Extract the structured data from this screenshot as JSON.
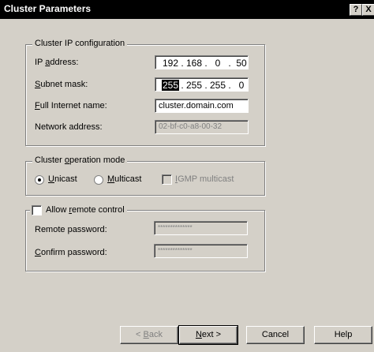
{
  "window": {
    "title": "Cluster Parameters",
    "help_glyph": "?",
    "close_glyph": "X"
  },
  "cluster_ip": {
    "group_label": "Cluster IP configuration",
    "ip_label_pre": "IP ",
    "ip_label_key": "a",
    "ip_label_post": "ddress:",
    "ip_octets": [
      "192",
      "168",
      "0",
      "50"
    ],
    "subnet_label_key": "S",
    "subnet_label_post": "ubnet mask:",
    "subnet_octets": [
      "255",
      "255",
      "255",
      "0"
    ],
    "fullname_label_key": "F",
    "fullname_label_post": "ull Internet name:",
    "fullname_value": "cluster.domain.com",
    "network_label": "Network address:",
    "network_value": "02-bf-c0-a8-00-32",
    "dot": "."
  },
  "operation_mode": {
    "group_label_pre": "Cluster ",
    "group_label_key": "o",
    "group_label_post": "peration mode",
    "unicast_key": "U",
    "unicast_post": "nicast",
    "multicast_key": "M",
    "multicast_post": "ulticast",
    "igmp_key": "I",
    "igmp_post": "GMP multicast",
    "selected": "Unicast"
  },
  "remote_control": {
    "checkbox_pre": "Allow ",
    "checkbox_key": "r",
    "checkbox_post": "emote control",
    "checked": false,
    "password_label": "Remote password:",
    "password_value": "**************",
    "confirm_key": "C",
    "confirm_post": "onfirm password:",
    "confirm_value": "**************"
  },
  "buttons": {
    "back_pre": "< ",
    "back_key": "B",
    "back_post": "ack",
    "next_key": "N",
    "next_post": "ext >",
    "cancel": "Cancel",
    "help": "Help"
  }
}
